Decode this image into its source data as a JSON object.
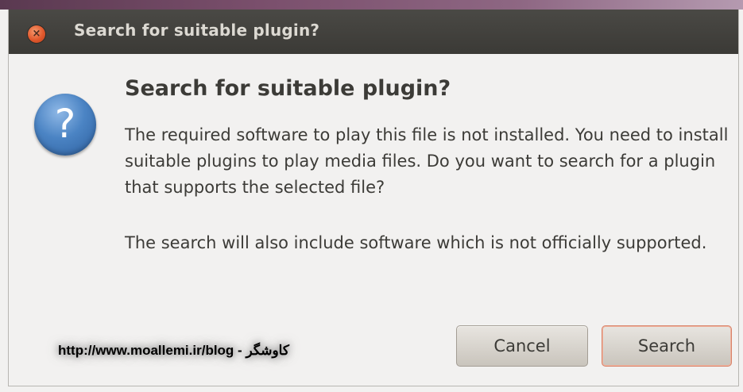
{
  "window": {
    "title": "Search for suitable plugin?"
  },
  "dialog": {
    "icon": "question-icon",
    "heading": "Search for suitable plugin?",
    "message": "The required software to play this file is not installed. You need to install suitable plugins to play media files. Do you want to search for a plugin that supports the selected file?",
    "note": "The search will also include software which is not officially supported."
  },
  "watermark": {
    "text": "http://www.moallemi.ir/blog - کاوشگر"
  },
  "buttons": {
    "cancel_label": "Cancel",
    "search_label": "Search"
  },
  "colors": {
    "titlebar": "#3c3b37",
    "background": "#f2f1f0",
    "close_button": "#e1582c",
    "icon_blue": "#4b84c4",
    "default_button_outline": "#d8836a"
  }
}
